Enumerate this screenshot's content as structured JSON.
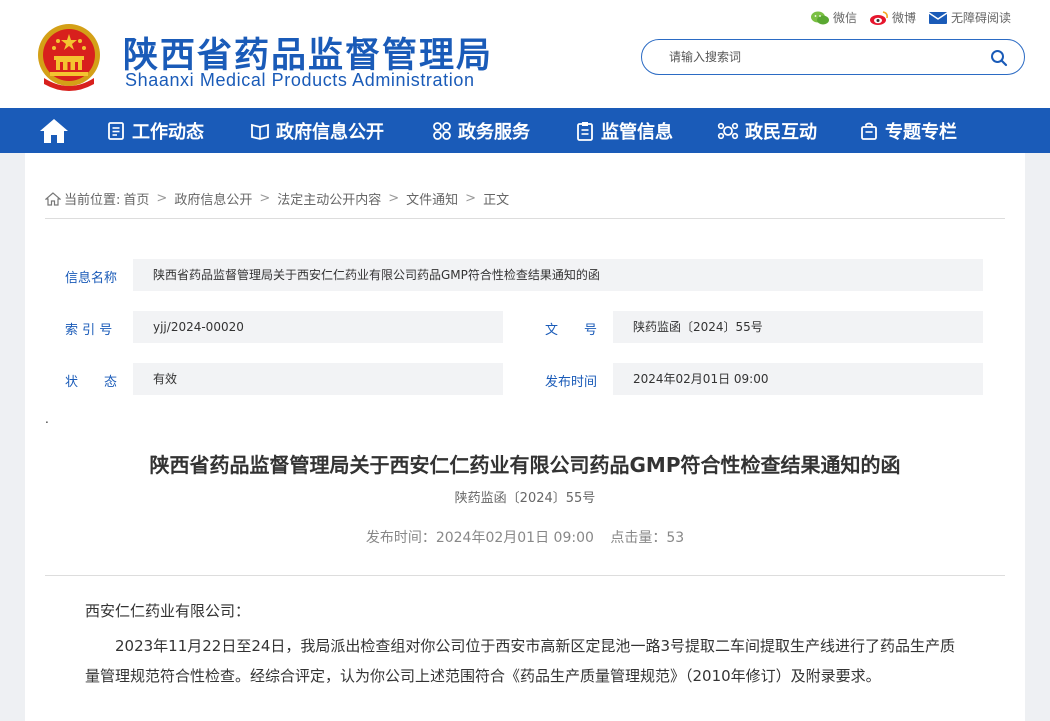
{
  "header": {
    "title": "陕西省药品监督管理局",
    "subtitle": "Shaanxi Medical Products Administration",
    "links": [
      {
        "label": "微信",
        "icon": "wechat-icon"
      },
      {
        "label": "微博",
        "icon": "weibo-icon"
      },
      {
        "label": "无障碍阅读",
        "icon": "mail-icon"
      }
    ],
    "search": {
      "placeholder": "请输入搜索词",
      "value": ""
    }
  },
  "nav": {
    "items": [
      {
        "label": "工作动态",
        "icon": "list-icon"
      },
      {
        "label": "政府信息公开",
        "icon": "book-icon"
      },
      {
        "label": "政务服务",
        "icon": "grid-icon"
      },
      {
        "label": "监管信息",
        "icon": "clipboard-icon"
      },
      {
        "label": "政民互动",
        "icon": "interaction-icon"
      },
      {
        "label": "专题专栏",
        "icon": "bag-icon"
      }
    ]
  },
  "breadcrumb": {
    "prefix": "当前位置:",
    "items": [
      "首页",
      "政府信息公开",
      "法定主动公开内容",
      "文件通知",
      "正文"
    ]
  },
  "info": {
    "name_label": "信息名称",
    "name_value": "陕西省药品监督管理局关于西安仁仁药业有限公司药品GMP符合性检查结果通知的函",
    "index_label": "索 引 号",
    "index_value": "yjj/2024-00020",
    "docno_label": "文　　号",
    "docno_value": "陕药监函〔2024〕55号",
    "status_label": "状　　态",
    "status_value": "有效",
    "date_label": "发布时间",
    "date_value": "2024年02月01日 09:00"
  },
  "article": {
    "dot": ".",
    "title": "陕西省药品监督管理局关于西安仁仁药业有限公司药品GMP符合性检查结果通知的函",
    "doc_no": "陕药监函〔2024〕55号",
    "publish": "发布时间：2024年02月01日 09:00",
    "clicks": "点击量：53",
    "salutation": "西安仁仁药业有限公司：",
    "paragraph": "2023年11月22日至24日，我局派出检查组对你公司位于西安市高新区定昆池一路3号提取二车间提取生产线进行了药品生产质量管理规范符合性检查。经综合评定，认为你公司上述范围符合《药品生产质量管理规范》（2010年修订）及附录要求。"
  },
  "colors": {
    "brand": "#1a5bb8",
    "info_bg": "#f2f3f5",
    "page_bg": "#eef0f3"
  }
}
